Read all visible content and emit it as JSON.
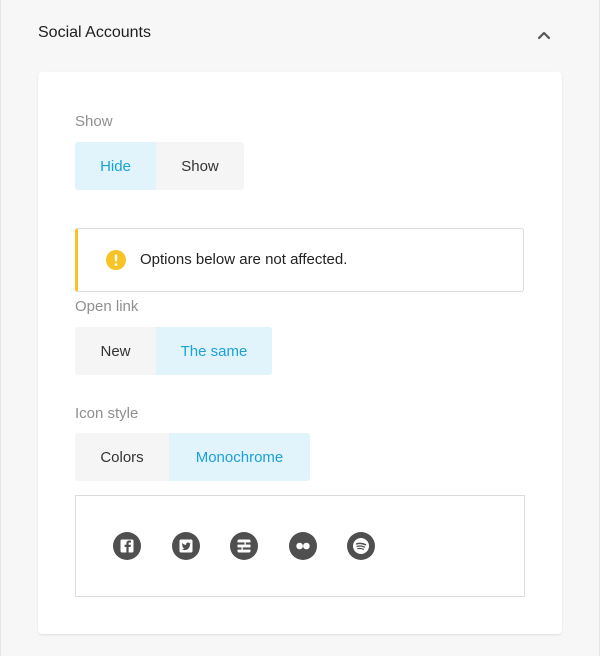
{
  "panel": {
    "title": "Social Accounts"
  },
  "show_field": {
    "label": "Show",
    "options": [
      "Hide",
      "Show"
    ],
    "selected": "Hide"
  },
  "notice": {
    "text": "Options below are not affected.",
    "icon": "warning-icon",
    "accent_color": "#f7c325"
  },
  "open_link_field": {
    "label": "Open link",
    "options": [
      "New",
      "The same"
    ],
    "selected": "The same"
  },
  "icon_style_field": {
    "label": "Icon style",
    "options": [
      "Colors",
      "Monochrome"
    ],
    "selected": "Monochrome"
  },
  "social_icons": [
    "facebook-icon",
    "twitter-icon",
    "xing-icon",
    "flickr-icon",
    "spotify-icon"
  ],
  "colors": {
    "active_bg": "#e1f4fc",
    "active_text": "#1da1d6",
    "inactive_bg": "#f5f5f5",
    "icon_fill": "#4f4f4f"
  }
}
